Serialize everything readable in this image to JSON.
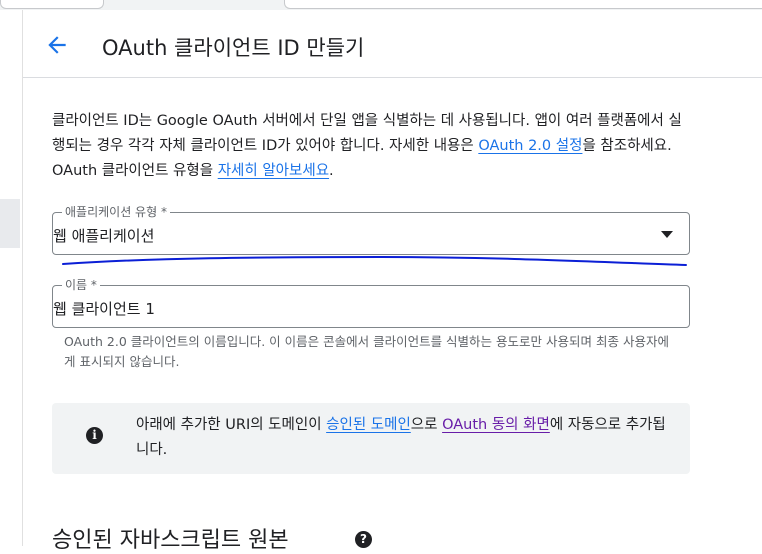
{
  "header": {
    "title": "OAuth 클라이언트 ID 만들기"
  },
  "description": {
    "part1": "클라이언트 ID는 Google OAuth 서버에서 단일 앱을 식별하는 데 사용됩니다. 앱이 여러 플랫폼에서 실행되는 경우 각각 자체 클라이언트 ID가 있어야 합니다. 자세한 내용은 ",
    "link1": "OAuth 2.0 설정",
    "part2": "을 참조하세요. OAuth 클라이언트 유형을 ",
    "link2": "자세히 알아보세요",
    "part3": "."
  },
  "app_type": {
    "label": "애플리케이션 유형 *",
    "value": "웹 애플리케이션"
  },
  "name_field": {
    "label": "이름 *",
    "value": "웹 클라이언트 1",
    "hint": "OAuth 2.0 클라이언트의 이름입니다. 이 이름은 콘솔에서 클라이언트를 식별하는 용도로만 사용되며 최종 사용자에게 표시되지 않습니다."
  },
  "info": {
    "part1": "아래에 추가한 URI의 도메인이 ",
    "link1": "승인된 도메인",
    "part2": "으로 ",
    "link2": "OAuth 동의 화면",
    "part3": "에 자동으로 추가됩니다."
  },
  "section": {
    "title": "승인된 자바스크립트 원본"
  },
  "icons": {
    "back": "arrow-back-icon",
    "dropdown": "dropdown-arrow-icon",
    "info": "info-icon",
    "help": "help-icon"
  },
  "colors": {
    "link": "#1a73e8",
    "visited_link": "#681da8",
    "annotation": "#0b1fd6"
  }
}
